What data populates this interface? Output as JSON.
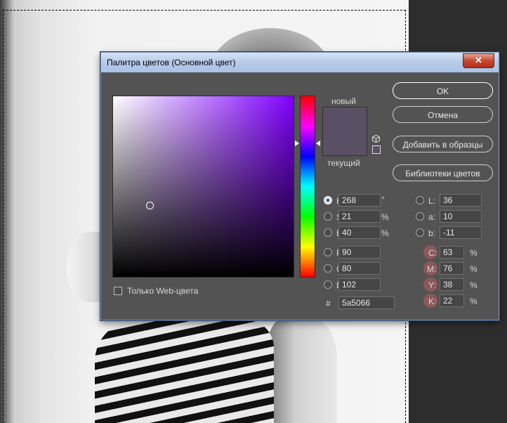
{
  "dialog": {
    "title": "Палитра цветов (Основной цвет)",
    "close_label": "✕"
  },
  "preview": {
    "new_label": "новый",
    "current_label": "текущий",
    "new_color": "#5a5066",
    "current_color": "#5a5066"
  },
  "buttons": {
    "ok": "OK",
    "cancel": "Отмена",
    "add_to_swatches": "Добавить в образцы",
    "color_libraries": "Библиотеки цветов"
  },
  "hsb": {
    "h_label": "H:",
    "h_value": "268",
    "h_unit": "°",
    "s_label": "S:",
    "s_value": "21",
    "s_unit": "%",
    "b_label": "B:",
    "b_value": "40",
    "b_unit": "%"
  },
  "rgb": {
    "r_label": "R:",
    "r_value": "90",
    "g_label": "G:",
    "g_value": "80",
    "b_label": "B:",
    "b_value": "102"
  },
  "lab": {
    "l_label": "L:",
    "l_value": "36",
    "a_label": "a:",
    "a_value": "10",
    "b_label": "b:",
    "b_value": "-11"
  },
  "cmyk": {
    "c_label": "C:",
    "c_value": "63",
    "c_unit": "%",
    "m_label": "M:",
    "m_value": "76",
    "m_unit": "%",
    "y_label": "Y:",
    "y_value": "38",
    "y_unit": "%",
    "k_label": "K:",
    "k_value": "22",
    "k_unit": "%"
  },
  "hex": {
    "label": "#",
    "value": "5a5066"
  },
  "web_only": {
    "label": "Только Web-цвета",
    "checked": false
  },
  "selected_mode": "H",
  "colors": {
    "dialog_bg": "#535353",
    "titlebar": "#b8cce9",
    "close_button": "#c8462f",
    "selected_color": "#5a5066"
  },
  "icons": [
    "close-icon",
    "cube-icon",
    "websafe-square-icon",
    "radio-icon",
    "checkbox-icon"
  ]
}
